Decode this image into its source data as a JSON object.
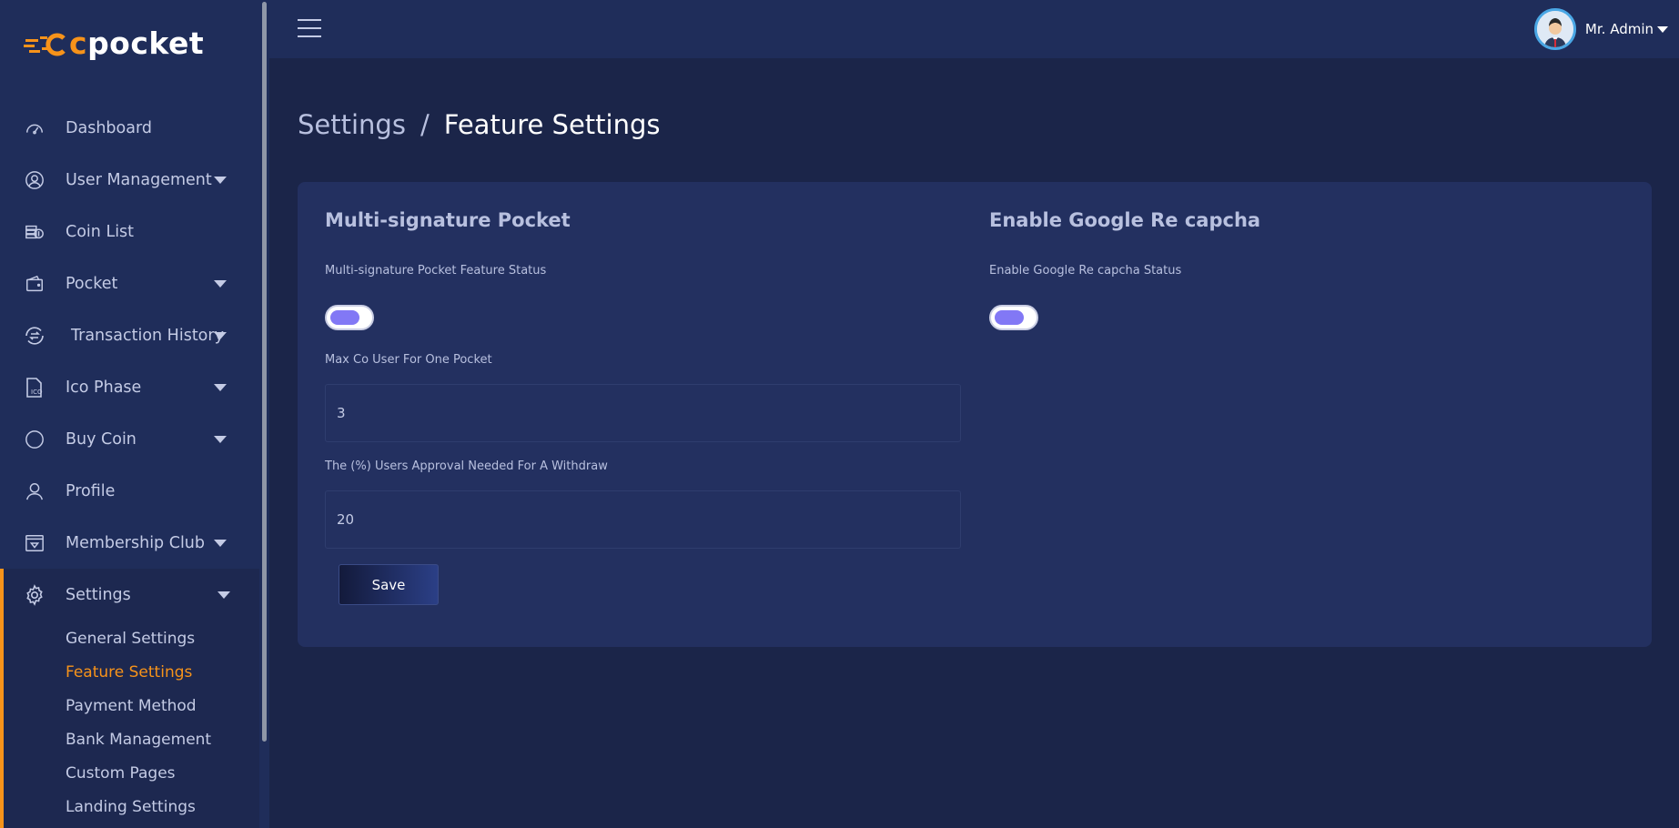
{
  "app": {
    "logo_text_prefix": "c",
    "logo_text_suffix": "pocket",
    "brand_color": "#f7931a"
  },
  "sidebar": {
    "items": [
      {
        "label": "Dashboard",
        "icon": "speedometer-icon",
        "has_caret": false
      },
      {
        "label": "User Management",
        "icon": "user-circle-icon",
        "has_caret": true
      },
      {
        "label": "Coin List",
        "icon": "coins-icon",
        "has_caret": false
      },
      {
        "label": "Pocket",
        "icon": "wallet-icon",
        "has_caret": true
      },
      {
        "label": "Transaction History",
        "icon": "exchange-icon",
        "has_caret": true
      },
      {
        "label": "Ico Phase",
        "icon": "ico-file-icon",
        "has_caret": true
      },
      {
        "label": "Buy Coin",
        "icon": "circle-icon",
        "has_caret": true
      },
      {
        "label": "Profile",
        "icon": "user-icon",
        "has_caret": false
      },
      {
        "label": "Membership Club",
        "icon": "diamond-card-icon",
        "has_caret": true
      }
    ],
    "settings": {
      "label": "Settings",
      "icon": "gear-icon",
      "submenu": [
        {
          "label": "General Settings",
          "active": false
        },
        {
          "label": "Feature Settings",
          "active": true
        },
        {
          "label": "Payment Method",
          "active": false
        },
        {
          "label": "Bank Management",
          "active": false
        },
        {
          "label": "Custom Pages",
          "active": false
        },
        {
          "label": "Landing Settings",
          "active": false
        }
      ]
    }
  },
  "header": {
    "user_name": "Mr. Admin"
  },
  "breadcrumb": {
    "parent": "Settings",
    "separator": "/",
    "current": "Feature Settings"
  },
  "multisig": {
    "title": "Multi-signature Pocket",
    "status_label": "Multi-signature Pocket Feature Status",
    "max_users_label": "Max Co User For One Pocket",
    "max_users_value": "3",
    "approval_label": "The (%) Users Approval Needed For A Withdraw",
    "approval_value": "20",
    "save_label": "Save"
  },
  "recaptcha": {
    "title": "Enable Google Re capcha",
    "status_label": "Enable Google Re capcha Status"
  }
}
